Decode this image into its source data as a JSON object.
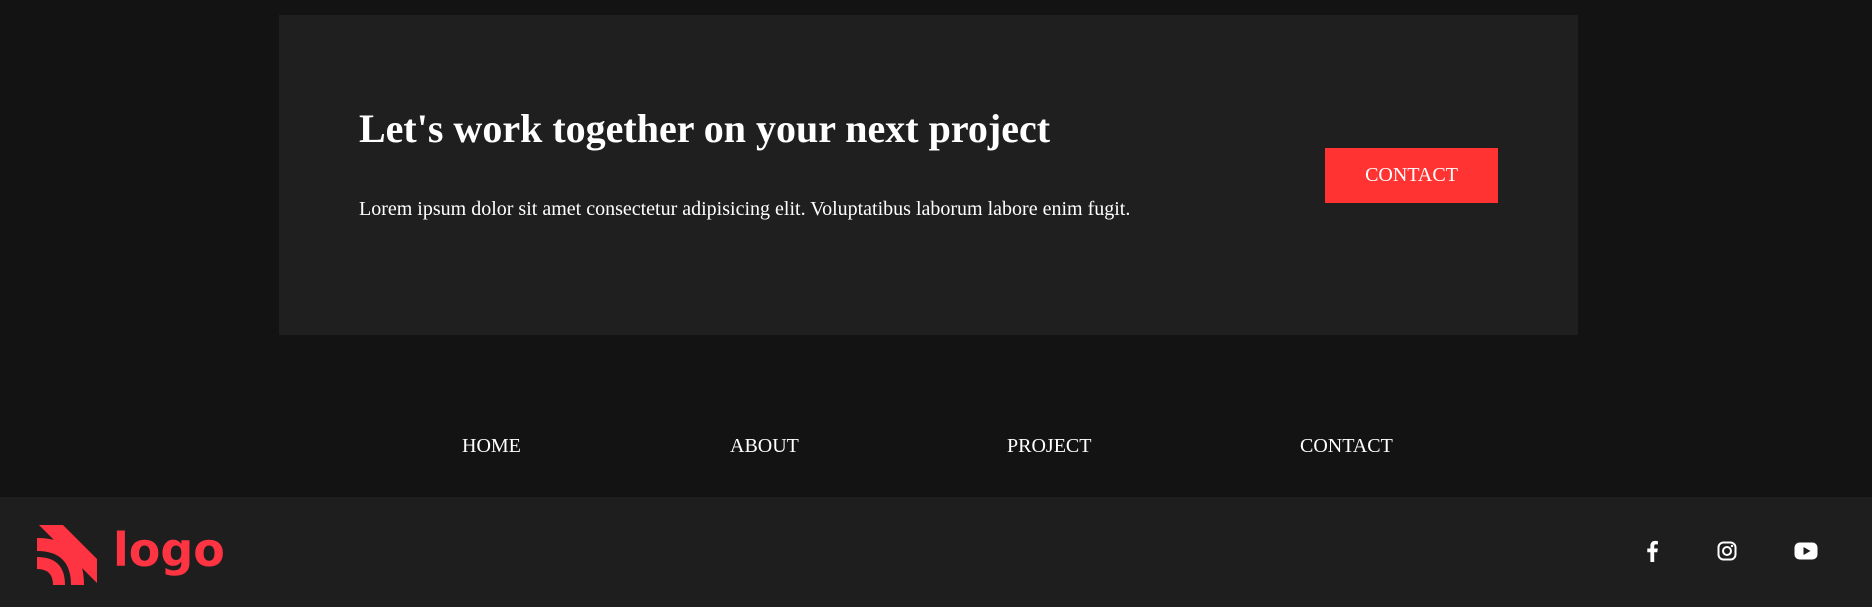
{
  "cta": {
    "heading": "Let's work together on your next project",
    "text": "Lorem ipsum dolor sit amet consectetur adipisicing elit. Voluptatibus laborum labore enim fugit.",
    "button_label": "CONTACT"
  },
  "nav": {
    "items": [
      {
        "label": "HOME"
      },
      {
        "label": "ABOUT"
      },
      {
        "label": "PROJECT"
      },
      {
        "label": "CONTACT"
      }
    ]
  },
  "footer": {
    "logo_text": "logo",
    "social_icons": [
      "facebook-icon",
      "instagram-icon",
      "youtube-icon"
    ]
  },
  "colors": {
    "page_bg": "#131313",
    "panel_bg": "#1f1f1f",
    "footer_bg": "#1e1e1e",
    "accent": "#ff3432",
    "logo": "#ff3442",
    "text": "#ffffff"
  }
}
